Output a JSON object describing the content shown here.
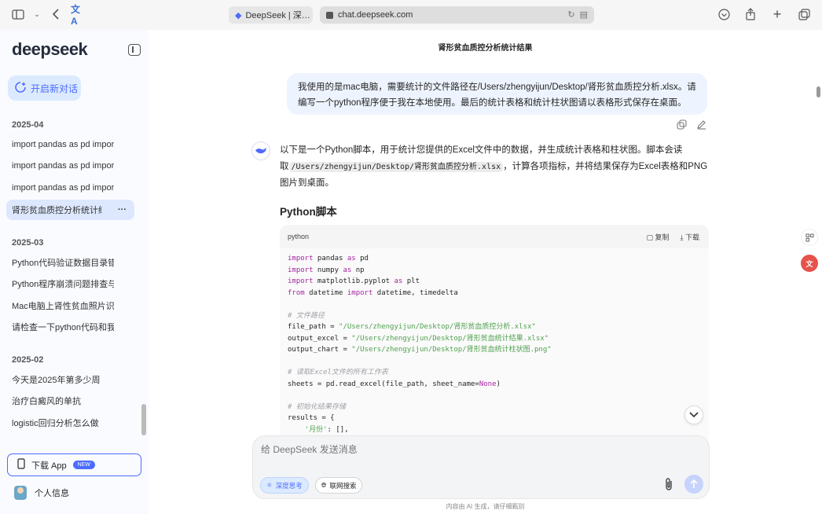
{
  "browser": {
    "tab_title": "DeepSeek | 深…",
    "url": "chat.deepseek.com"
  },
  "sidebar": {
    "logo": "deepseek",
    "new_chat": "开启新对话",
    "groups": [
      {
        "label": "2025-04",
        "items": [
          {
            "label": "import pandas as pd import nur"
          },
          {
            "label": "import pandas as pd import nur"
          },
          {
            "label": "import pandas as pd import nur"
          },
          {
            "label": "肾形贫血质控分析统计结果",
            "active": true
          }
        ]
      },
      {
        "label": "2025-03",
        "items": [
          {
            "label": "Python代码验证数据目录错误排查"
          },
          {
            "label": "Python程序崩溃问题排查与解决方"
          },
          {
            "label": "Mac电脑上肾性贫血照片识别模型"
          },
          {
            "label": "请检查一下python代码和我发给你"
          }
        ]
      },
      {
        "label": "2025-02",
        "items": [
          {
            "label": "今天是2025年第多少周"
          },
          {
            "label": "治疗白癜风的单抗"
          },
          {
            "label": "logistic回归分析怎么做"
          }
        ]
      }
    ],
    "download_app": "下载 App",
    "new_badge": "NEW",
    "profile": "个人信息"
  },
  "main": {
    "title": "肾形贫血质控分析统计结果",
    "user_message": "我使用的是mac电脑，需要统计的文件路径在/Users/zhengyijun/Desktop/肾形贫血质控分析.xlsx。请编写一个python程序便于我在本地使用。最后的统计表格和统计柱状图请以表格形式保存在桌面。",
    "bot_intro_1": "以下是一个Python脚本，用于统计您提供的Excel文件中的数据，并生成统计表格和柱状图。脚本会读取",
    "bot_intro_code": "/Users/zhengyijun/Desktop/肾形贫血质控分析.xlsx",
    "bot_intro_2": "，计算各项指标，并将结果保存为Excel表格和PNG图片到桌面。",
    "section_title": "Python脚本",
    "code_lang": "python",
    "copy_label": "复制",
    "download_label": "下载",
    "composer_placeholder": "给 DeepSeek 发送消息",
    "deep_think": "深度思考",
    "web_search": "联网搜索",
    "disclaimer": "内容由 AI 生成，请仔细甄别"
  },
  "code": {
    "l1_kw": "import",
    "l1_rest": " pandas ",
    "l1_kw2": "as",
    "l1_end": " pd",
    "l2_kw": "import",
    "l2_rest": " numpy ",
    "l2_kw2": "as",
    "l2_end": " np",
    "l3_kw": "import",
    "l3_rest": " matplotlib.pyplot ",
    "l3_kw2": "as",
    "l3_end": " plt",
    "l4_kw": "from",
    "l4_rest": " datetime ",
    "l4_kw2": "import",
    "l4_end": " datetime, timedelta",
    "c1": "# 文件路径",
    "l5_a": "file_path = ",
    "l5_s": "\"/Users/zhengyijun/Desktop/肾形贫血质控分析.xlsx\"",
    "l6_a": "output_excel = ",
    "l6_s": "\"/Users/zhengyijun/Desktop/肾形贫血统计结果.xlsx\"",
    "l7_a": "output_chart = ",
    "l7_s": "\"/Users/zhengyijun/Desktop/肾形贫血统计柱状图.png\"",
    "c2": "# 读取Excel文件的所有工作表",
    "l8_a": "sheets = pd.read_excel(file_path, sheet_name=",
    "l8_k": "None",
    "l8_e": ")",
    "c3": "# 初始化结果存储",
    "l9": "results = {",
    "l10_s": "    '月份'",
    "l10_e": ": [],"
  }
}
